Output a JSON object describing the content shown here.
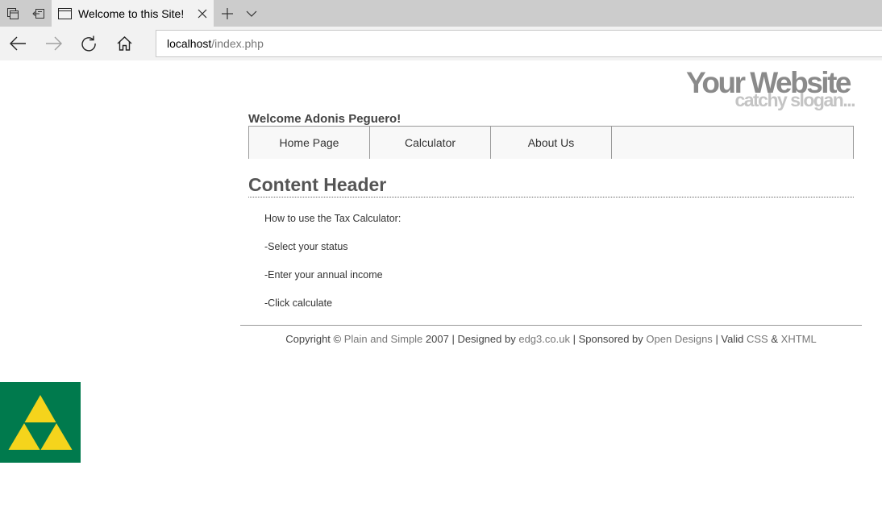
{
  "browser": {
    "tab": {
      "title": "Welcome to this Site!"
    },
    "address": {
      "host": "localhost",
      "path": "/index.php"
    },
    "icons": {
      "tab_manager": "tab-manager-icon",
      "set_aside": "set-aside-icon",
      "page": "page-icon",
      "close": "close-icon",
      "new_tab": "plus-icon",
      "tab_list": "chevron-down-icon",
      "back": "back-arrow-icon",
      "forward": "forward-arrow-icon",
      "refresh": "refresh-icon",
      "home": "home-icon"
    }
  },
  "site": {
    "title": "Your Website",
    "slogan": "catchy slogan...",
    "welcome": "Welcome Adonis Peguero!",
    "menu": [
      {
        "label": "Home Page"
      },
      {
        "label": "Calculator"
      },
      {
        "label": "About Us"
      }
    ],
    "content": {
      "header": "Content Header",
      "lines": [
        "How to use the Tax Calculator:",
        "-Select your status",
        "-Enter your annual income",
        "-Click calculate"
      ]
    },
    "footer": {
      "copyright": "Copyright ©",
      "plain_and_simple": "Plain and Simple",
      "year_designed_by": "2007 | Designed by",
      "designer": "edg3.co.uk",
      "sponsored_by": "| Sponsored by",
      "sponsor": "Open Designs",
      "valid": "| Valid",
      "css": "CSS",
      "amp": "&",
      "xhtml": "XHTML"
    },
    "logo": {
      "icon": "triforce-logo",
      "background": "#007a4d",
      "triangle_color": "#f5d41c"
    }
  },
  "colors": {
    "tabstrip": "#cccccc",
    "toolbar": "#f2f2f2",
    "title_gray": "#8a8a8a",
    "slogan_gray": "#c4c4c4"
  }
}
